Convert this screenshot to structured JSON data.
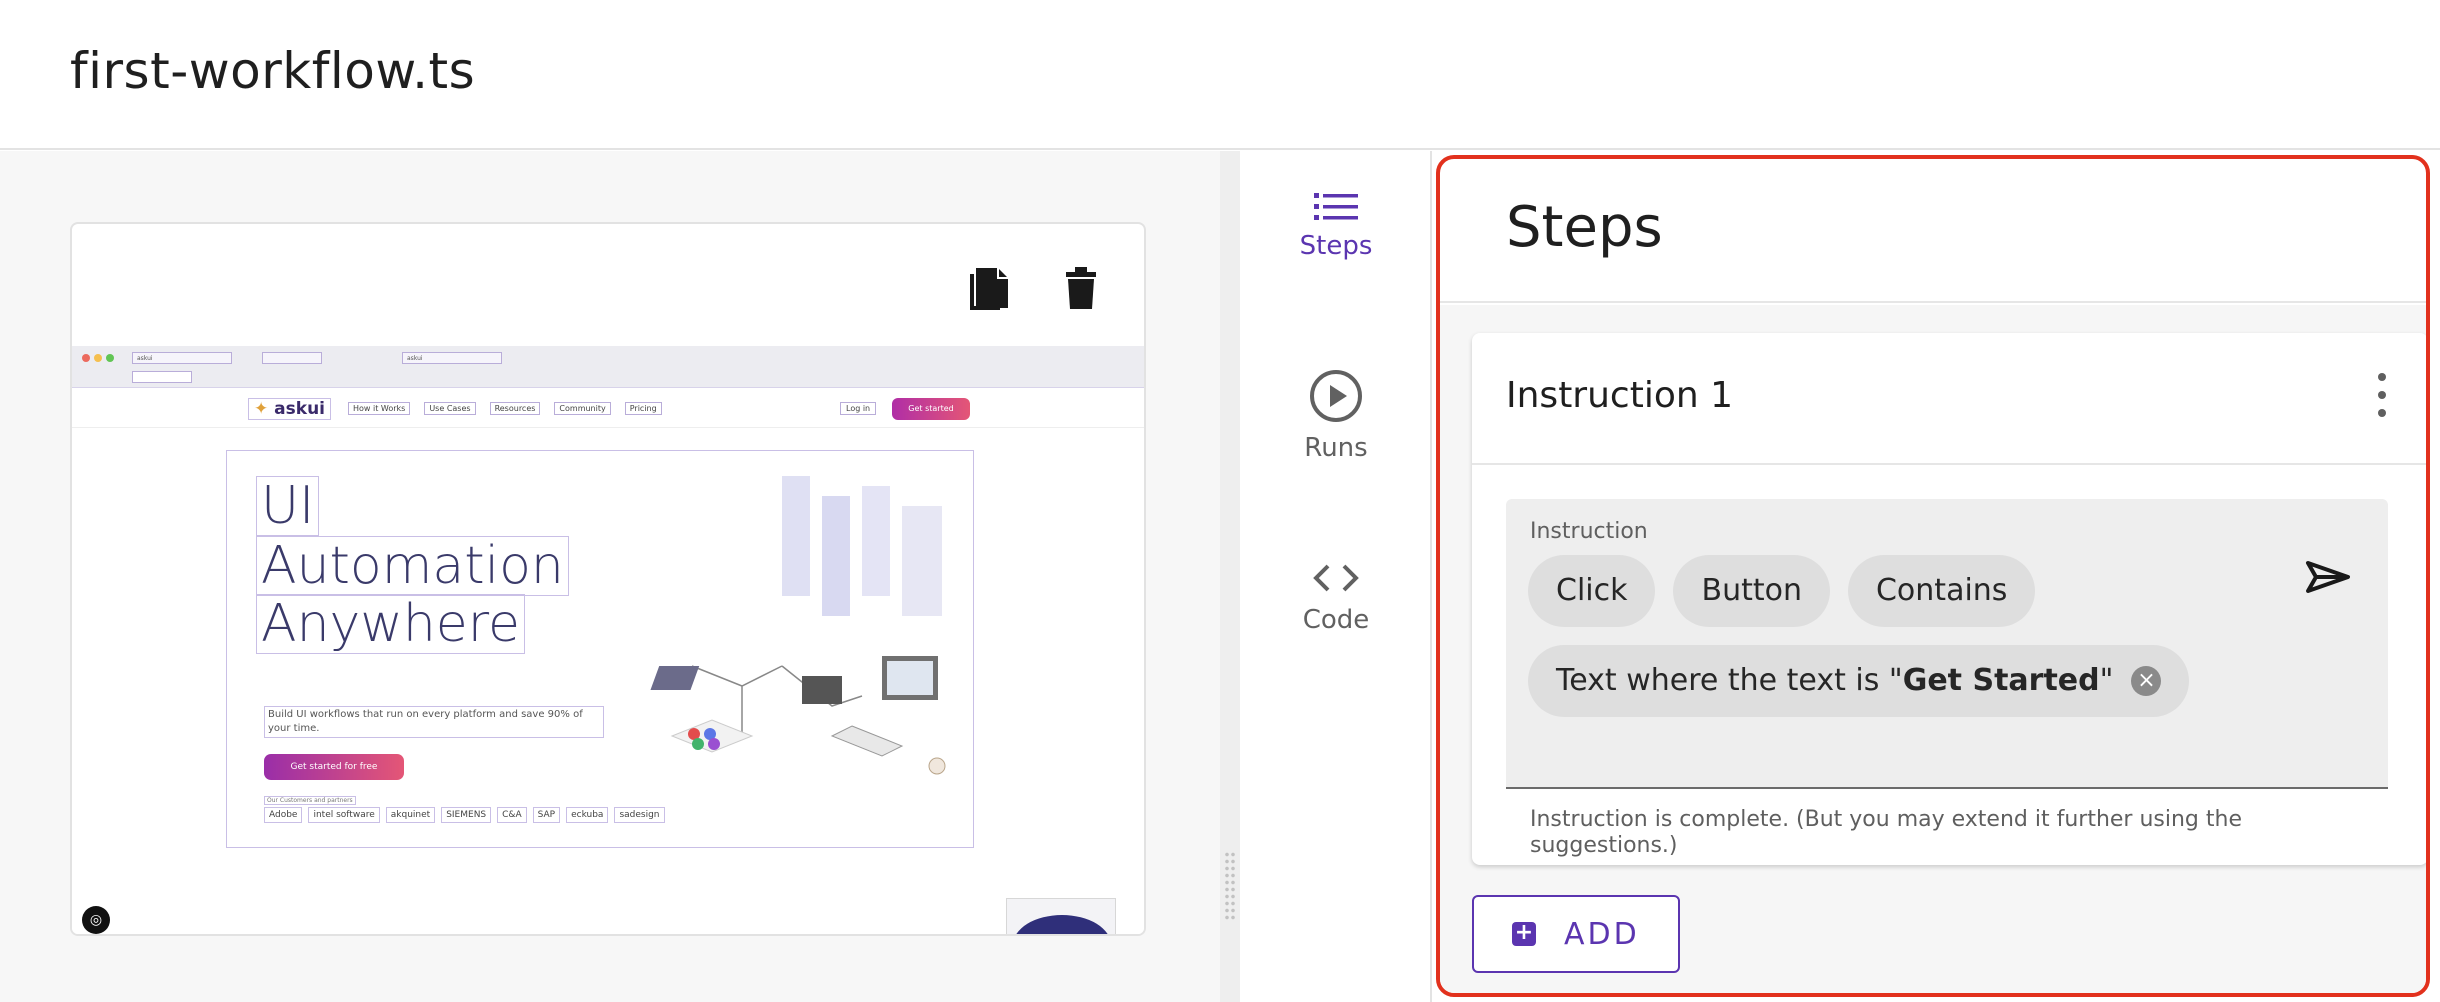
{
  "header": {
    "title": "first-workflow.ts"
  },
  "screenshot_card": {
    "actions": [
      {
        "icon": "copy-icon"
      },
      {
        "icon": "trash-icon"
      }
    ],
    "captured_page": {
      "logo": "askui",
      "nav_links": [
        "How it Works",
        "Use Cases",
        "Resources",
        "Community",
        "Pricing"
      ],
      "nav_login": "Log in",
      "nav_cta": "Get started",
      "hero_lines": [
        "UI",
        "Automation",
        "Anywhere"
      ],
      "hero_sub": "Build UI workflows that run on every platform and save 90% of your time.",
      "hero_button": "Get started for free",
      "trusted_label": "Our Customers and partners",
      "partner_logos": [
        "Adobe",
        "intel software",
        "akquinet",
        "SIEMENS",
        "C&A",
        "SAP",
        "eckuba",
        "sadesign"
      ]
    }
  },
  "rail": {
    "items": [
      {
        "label": "Steps",
        "icon": "list-icon",
        "active": true
      },
      {
        "label": "Runs",
        "icon": "play-circle-icon",
        "active": false
      },
      {
        "label": "Code",
        "icon": "code-icon",
        "active": false
      }
    ]
  },
  "steps_panel": {
    "title": "Steps",
    "instruction_card": {
      "title": "Instruction 1",
      "field_label": "Instruction",
      "chips": [
        "Click",
        "Button",
        "Contains"
      ],
      "text_chip": {
        "prefix": "Text where the text is \"",
        "bold": "Get Started",
        "suffix": "\""
      },
      "helper": "Instruction is complete. (But you may extend it further using the suggestions.)"
    },
    "add_button": "ADD"
  },
  "colors": {
    "accent": "#5b35b0",
    "highlight_border": "#e2311d"
  }
}
